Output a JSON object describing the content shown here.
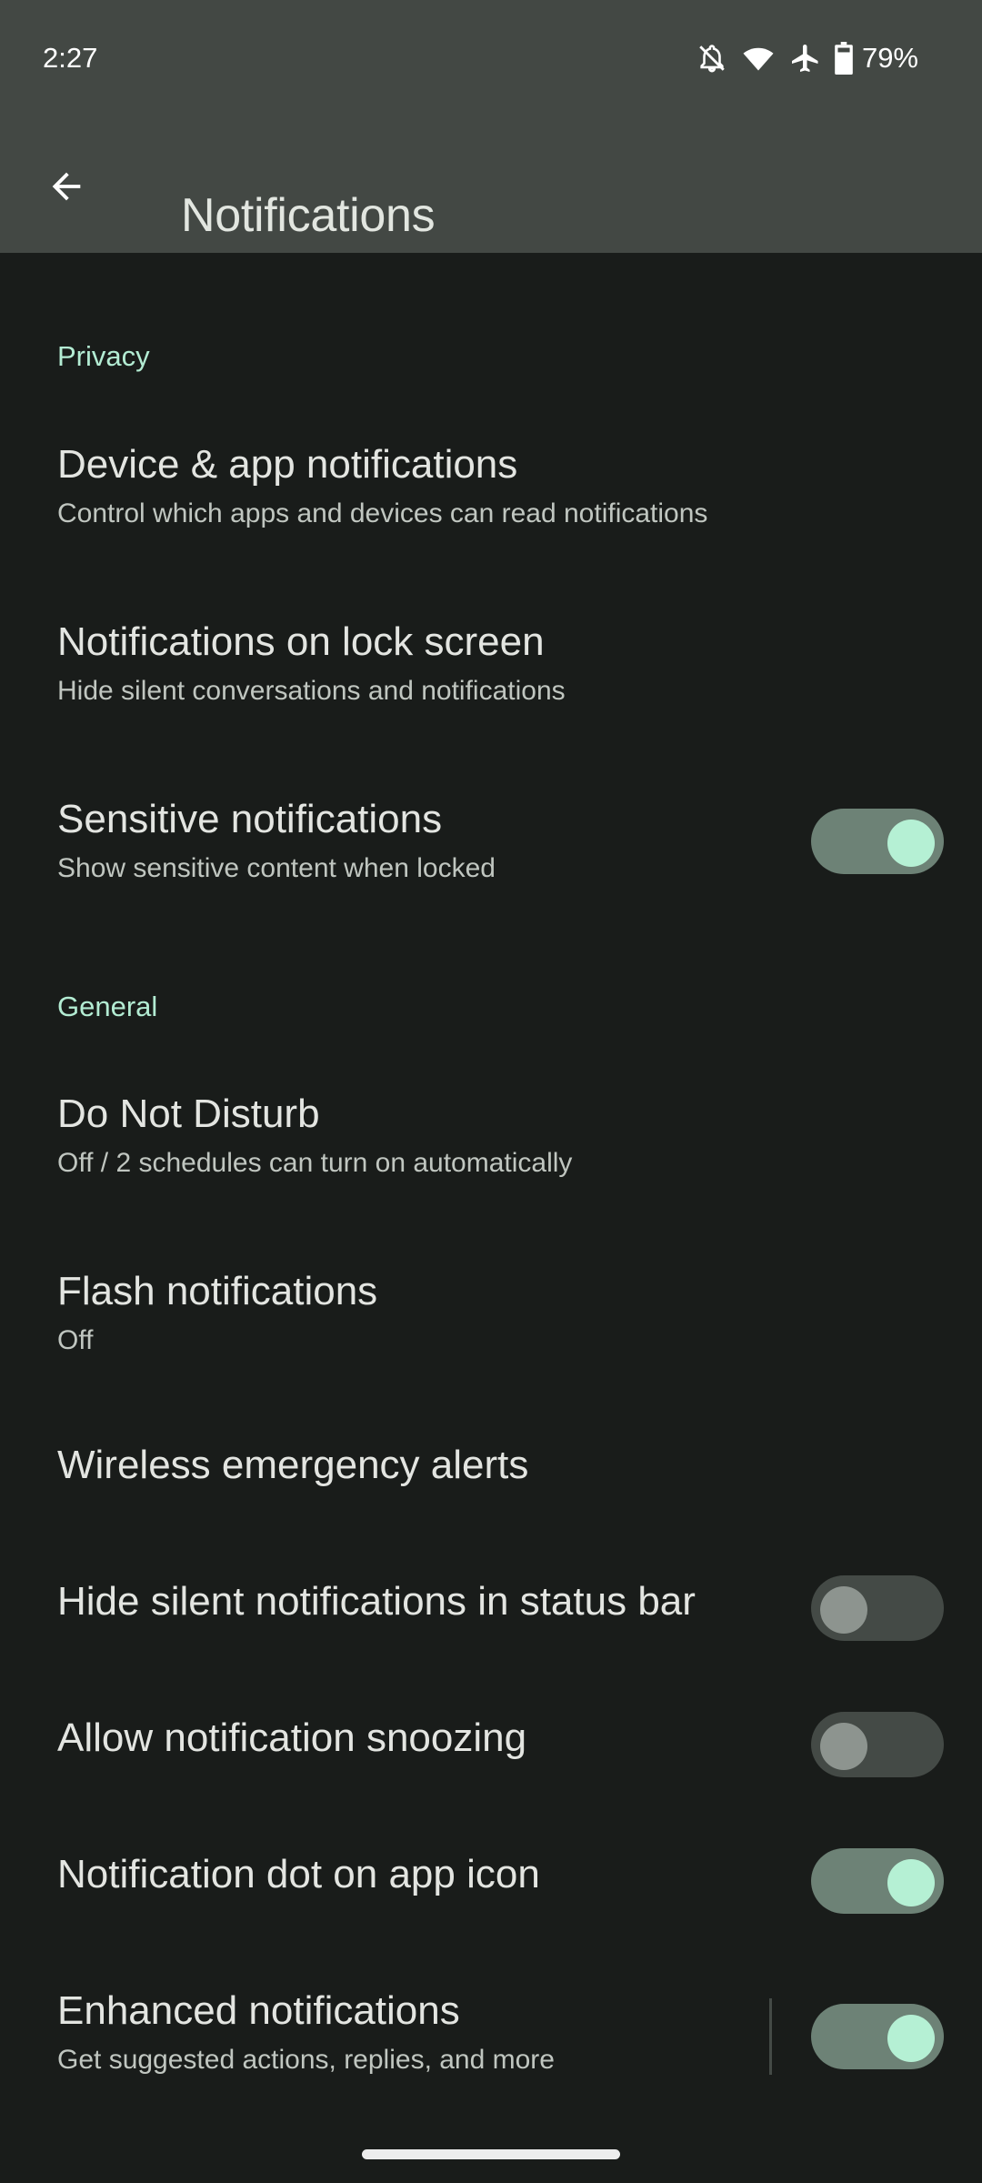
{
  "status_bar": {
    "time": "2:27",
    "icons": [
      "notifications-off-icon",
      "wifi-icon",
      "airplane-mode-icon",
      "battery-icon"
    ],
    "battery_percent": "79%"
  },
  "app_bar": {
    "back_icon": "arrow-back-icon",
    "title": "Notifications"
  },
  "colors": {
    "accent": "#b3ecd3",
    "switch_on_track": "#6d8276",
    "switch_on_thumb": "#b5f0d4",
    "switch_off_track": "#444a46",
    "switch_off_thumb": "#8d948f",
    "background": "#191c1a",
    "toolbar": "#434844"
  },
  "sections": [
    {
      "header": "Privacy",
      "items": [
        {
          "title": "Device & app notifications",
          "summary": "Control which apps and devices can read notifications"
        },
        {
          "title": "Notifications on lock screen",
          "summary": "Hide silent conversations and notifications"
        },
        {
          "title": "Sensitive notifications",
          "summary": "Show sensitive content when locked",
          "switch": true
        }
      ]
    },
    {
      "header": "General",
      "items": [
        {
          "title": "Do Not Disturb",
          "summary": "Off / 2 schedules can turn on automatically"
        },
        {
          "title": "Flash notifications",
          "summary": "Off"
        },
        {
          "title": "Wireless emergency alerts"
        },
        {
          "title": "Hide silent notifications in status bar",
          "switch": false
        },
        {
          "title": "Allow notification snoozing",
          "switch": false
        },
        {
          "title": "Notification dot on app icon",
          "switch": true
        },
        {
          "title": "Enhanced notifications",
          "summary": "Get suggested actions, replies, and more",
          "switch": true
        }
      ]
    }
  ]
}
